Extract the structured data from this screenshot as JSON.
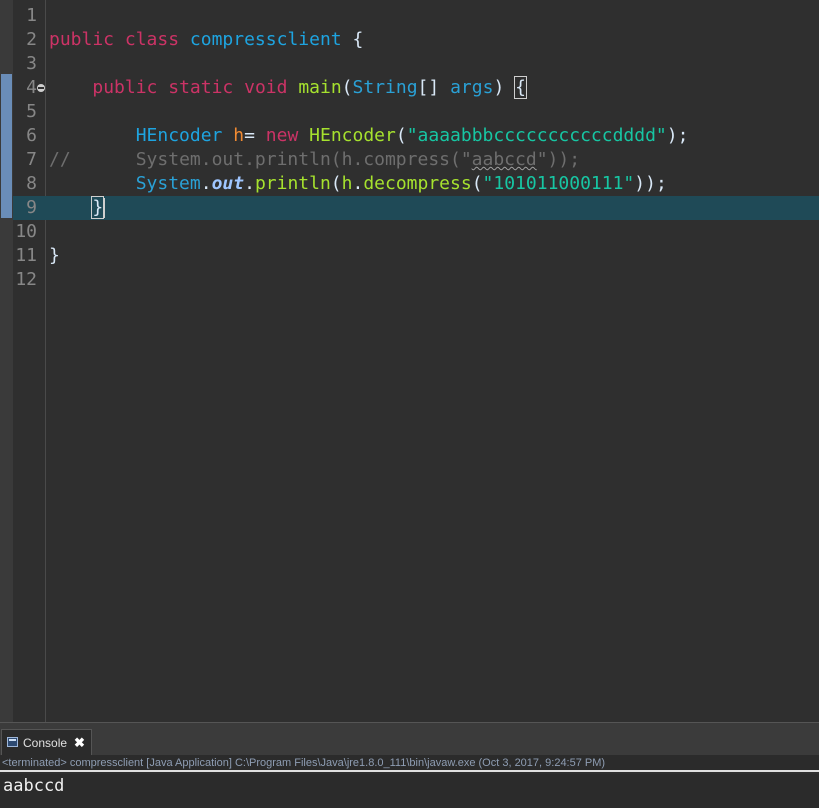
{
  "editor": {
    "line_numbers": [
      "1",
      "2",
      "3",
      "4",
      "5",
      "6",
      "7",
      "8",
      "9",
      "10",
      "11",
      "12"
    ],
    "line2": {
      "kw1": "public",
      "kw2": "class",
      "classname": "compressclient",
      "brace": "{"
    },
    "line4": {
      "kw1": "public",
      "kw2": "static",
      "kw3": "void",
      "method": "main",
      "paren_open": "(",
      "type": "String",
      "array": "[]",
      "param": "args",
      "paren_close": ")",
      "brace": "{"
    },
    "line6": {
      "type": "HEncoder",
      "var": "h",
      "op": "=",
      "kw": "new",
      "ctor": "HEncoder",
      "paren_open": "(",
      "str": "\"aaaabbbcccccccccccdddd\"",
      "end": ");"
    },
    "line7": {
      "comment": "//",
      "prefix": "System.out.println(h.compress(\"",
      "squiggle": "aabccd",
      "suffix": "\"));"
    },
    "line8": {
      "system": "System",
      "dot1": ".",
      "out": "out",
      "dot2": ".",
      "println": "println",
      "paren1": "(",
      "h": "h",
      "dot3": ".",
      "method": "decompress",
      "paren2": "(",
      "str": "\"101011000111\"",
      "end": "));"
    },
    "line9": {
      "brace": "}"
    },
    "line11": {
      "brace": "}"
    }
  },
  "console": {
    "tab_label": "Console",
    "close_glyph": "✖",
    "status": "<terminated> compressclient [Java Application] C:\\Program Files\\Java\\jre1.8.0_111\\bin\\javaw.exe (Oct 3, 2017, 9:24:57 PM)",
    "output": "aabccd"
  },
  "colors": {
    "background": "#2f2f2f",
    "keyword": "#cc3366",
    "class_name": "#1ea4e0",
    "string": "#17c6a3",
    "method": "#a6e22e",
    "variable": "#f28b32",
    "current_line": "#1f4a57"
  }
}
